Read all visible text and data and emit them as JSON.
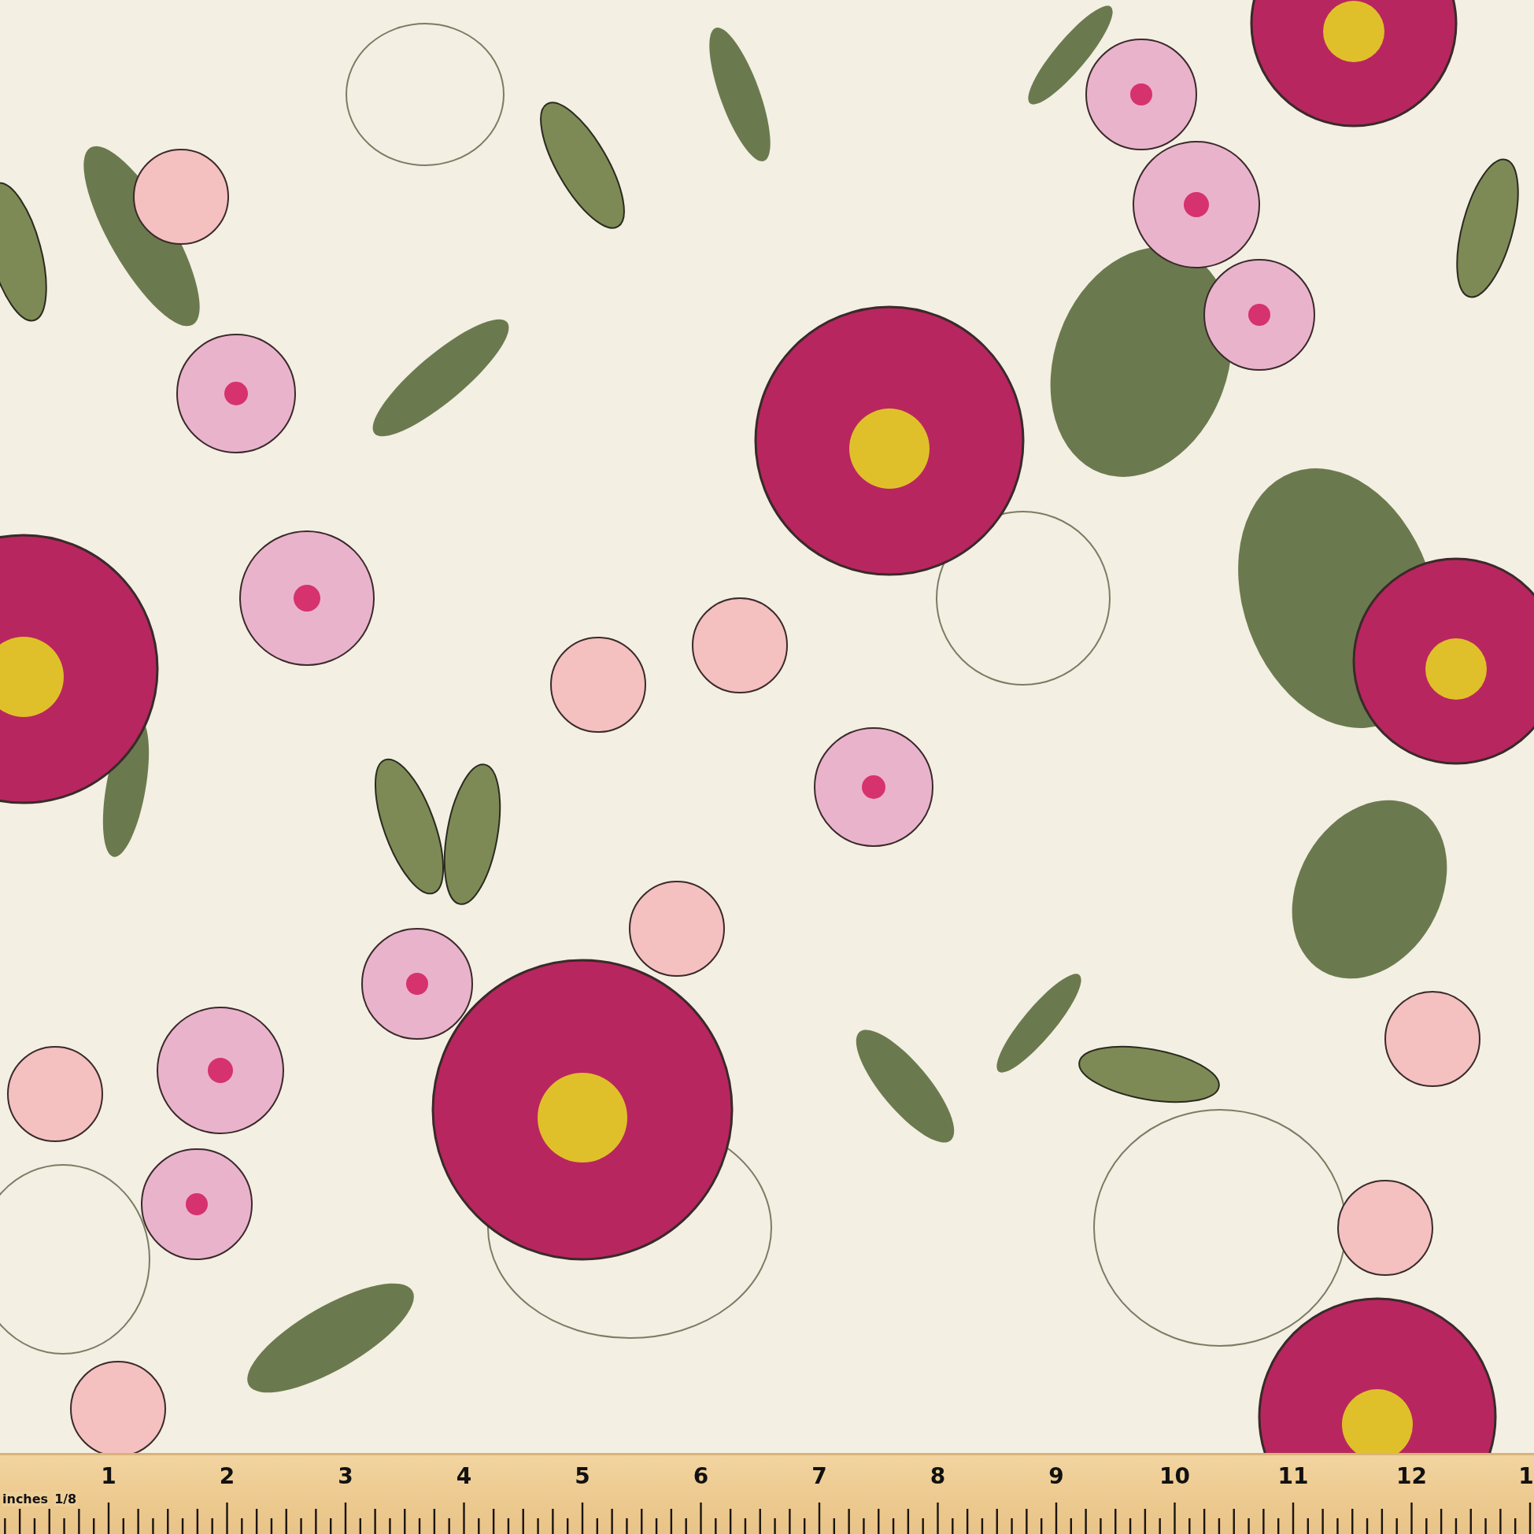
{
  "ruler": {
    "unit_label": "inches",
    "fraction_label": "1/8",
    "numbers": [
      "1",
      "2",
      "3",
      "4",
      "5",
      "6",
      "7",
      "8",
      "9",
      "10",
      "11",
      "12",
      "1"
    ]
  }
}
